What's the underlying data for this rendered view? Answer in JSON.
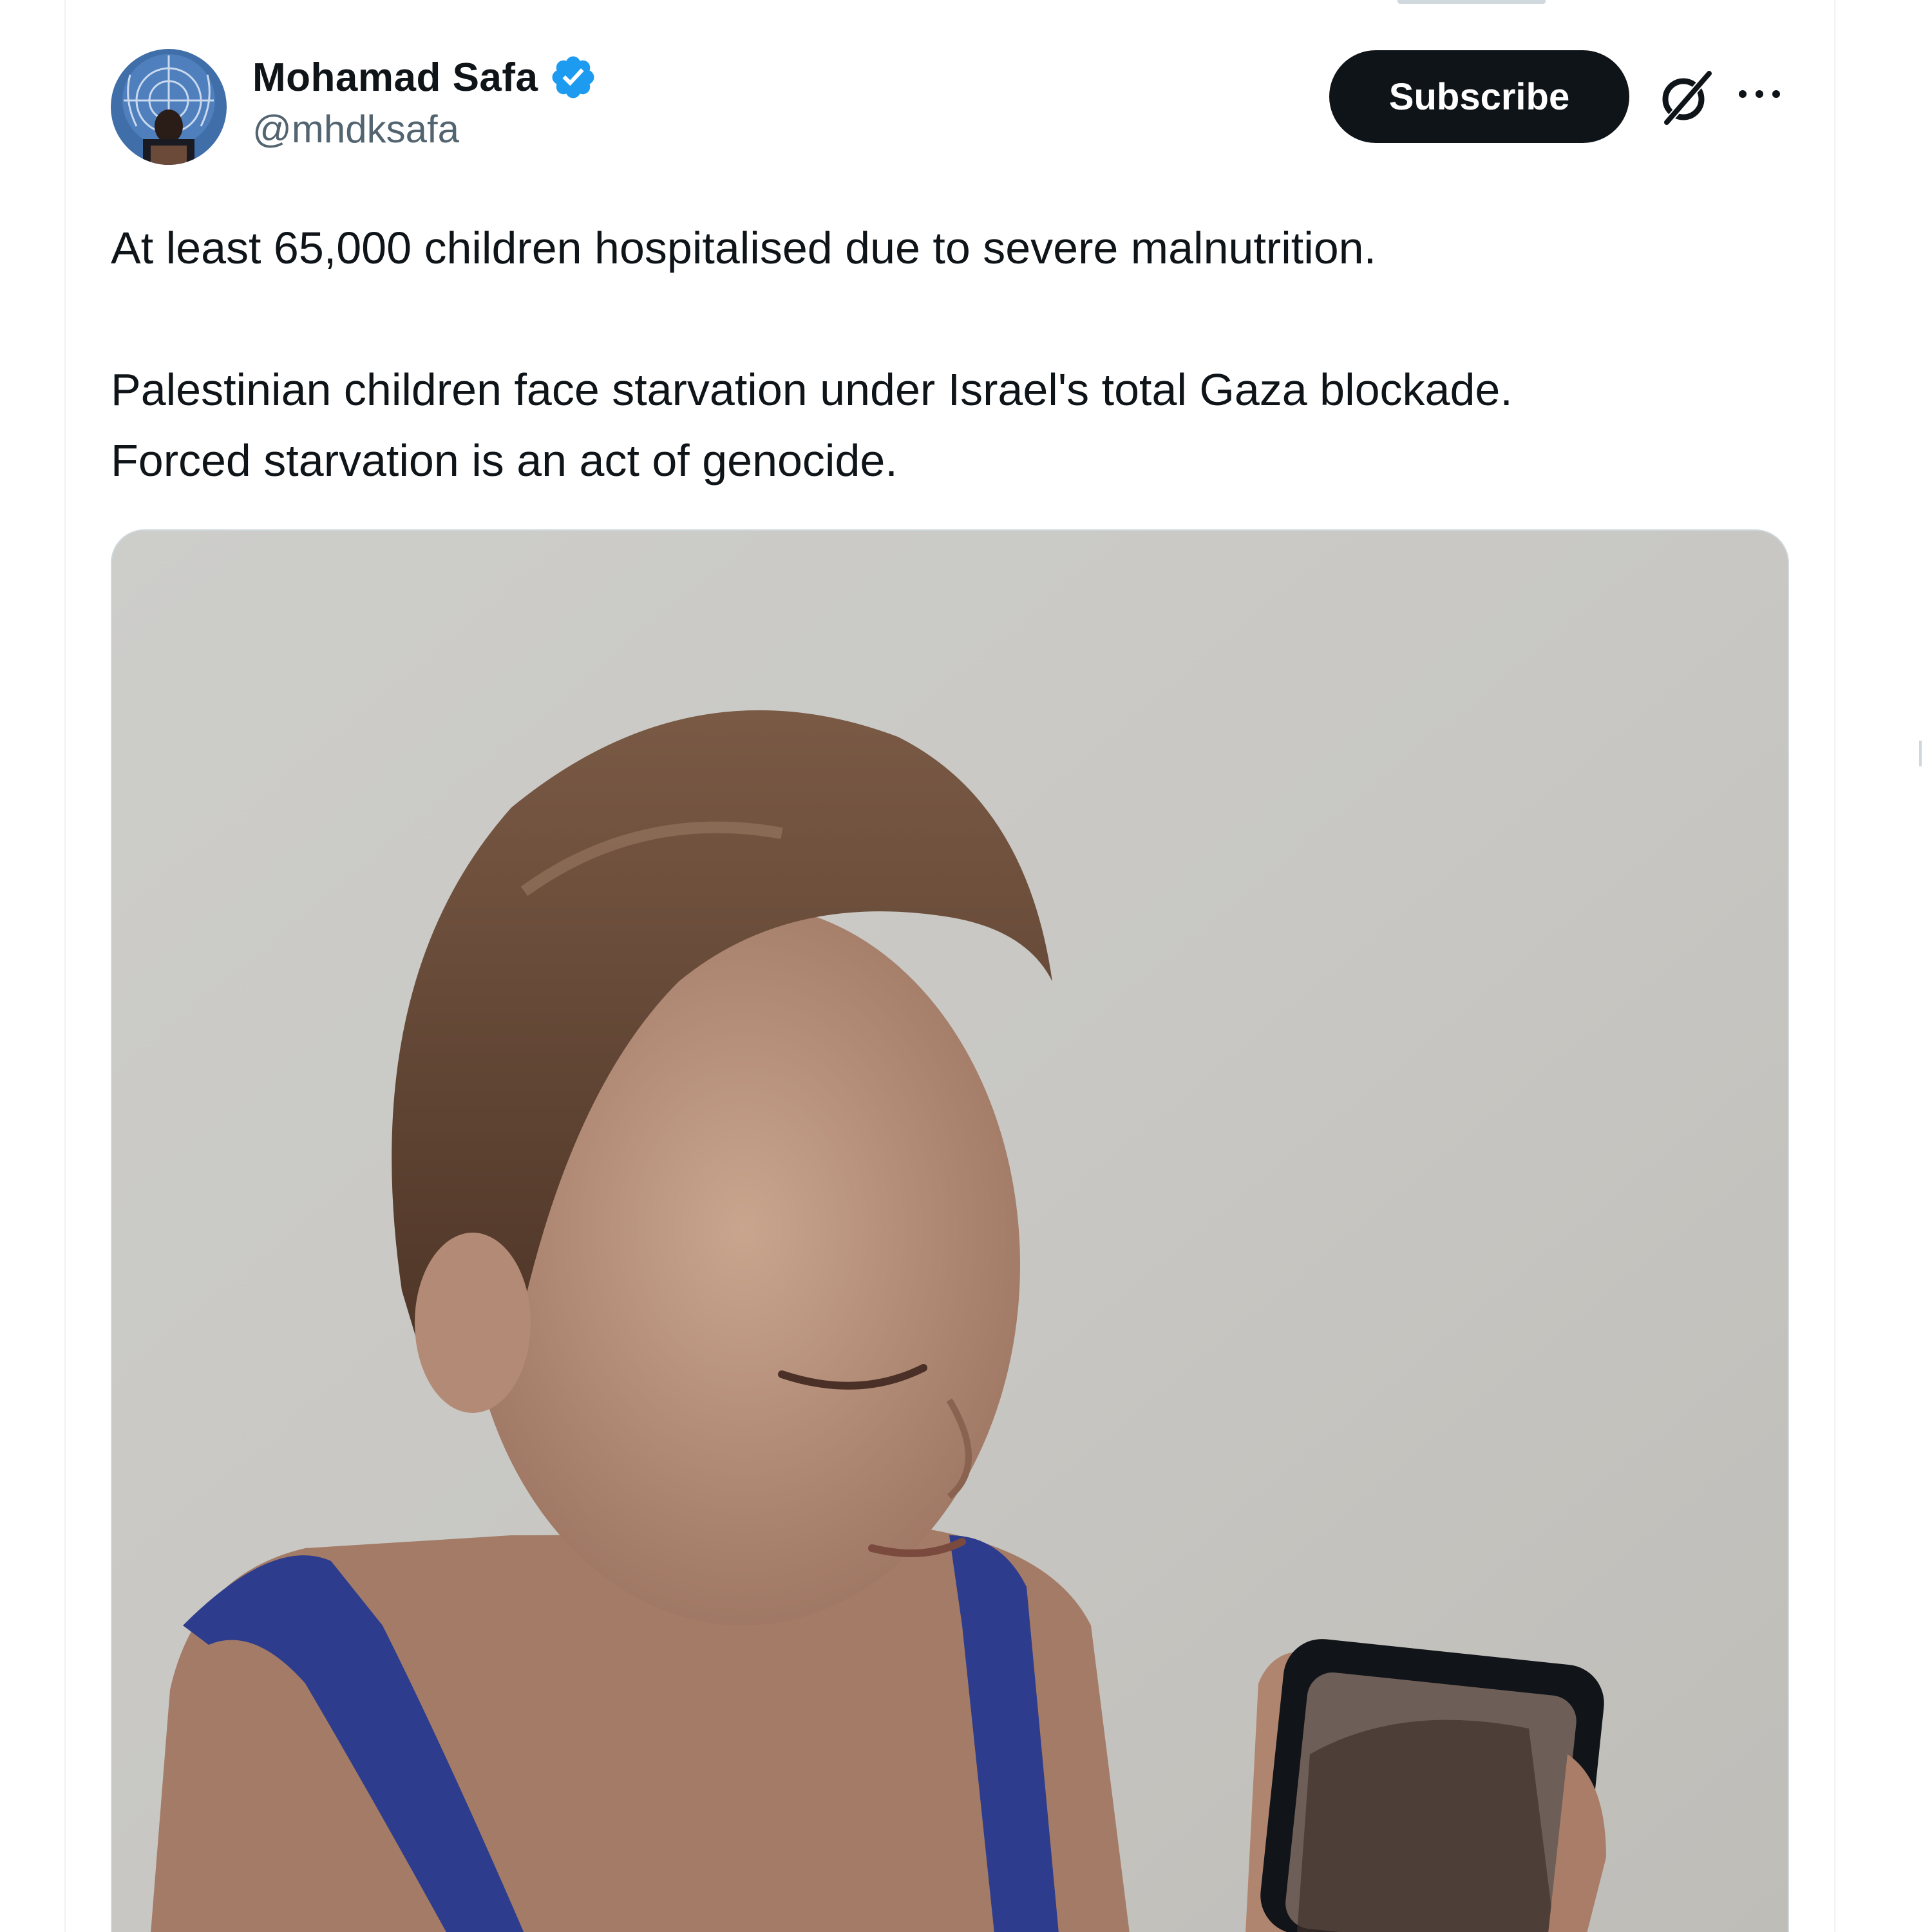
{
  "post": {
    "author": {
      "display_name": "Mohamad Safa",
      "handle": "@mhdksafa",
      "verified": true,
      "avatar_icon": "avatar-photo"
    },
    "actions": {
      "subscribe_label": "Subscribe",
      "grok_icon": "grok-icon",
      "more_icon": "more-icon"
    },
    "text": {
      "line1": "At least 65,000 children hospitalised due to severe malnutrition.",
      "line2": "Palestinian children face starvation under Israel's total Gaza blockade.",
      "line3": "Forced starvation is an act of genocide."
    },
    "media": {
      "type": "photo"
    }
  },
  "colors": {
    "text_primary": "#0f1419",
    "text_secondary": "#536471",
    "verified_blue": "#1d9bf0",
    "button_bg": "#0f1419",
    "button_text": "#ffffff",
    "border": "#eff3f4"
  }
}
